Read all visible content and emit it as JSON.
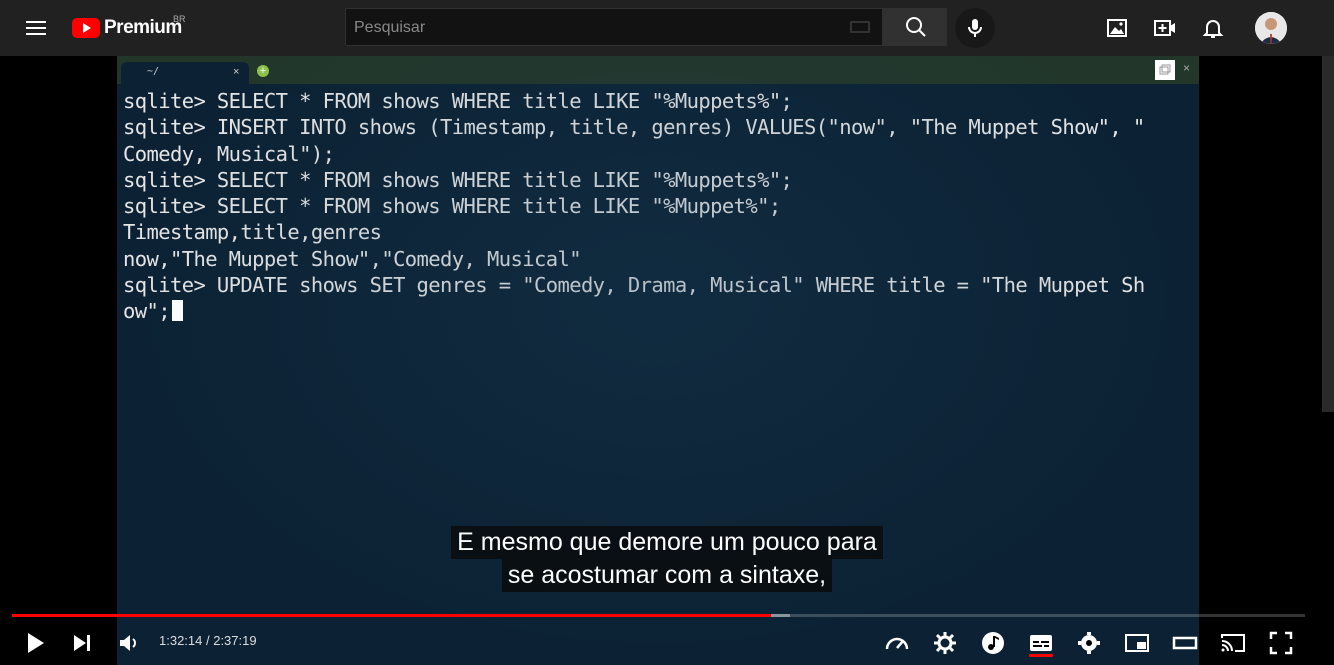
{
  "header": {
    "brand": "Premium",
    "region": "BR",
    "search_placeholder": "Pesquisar",
    "icons": [
      "menu-icon",
      "youtube-logo-icon",
      "keyboard-icon",
      "search-icon",
      "mic-icon",
      "image-icon",
      "create-video-icon",
      "notifications-icon",
      "avatar"
    ]
  },
  "terminal": {
    "tab_label": "~/",
    "tab_close": "×",
    "tab_add": "+",
    "window_close": "×",
    "text": "sqlite> SELECT * FROM shows WHERE title LIKE \"%Muppets%\";\nsqlite> INSERT INTO shows (Timestamp, title, genres) VALUES(\"now\", \"The Muppet Show\", \"\nComedy, Musical\");\nsqlite> SELECT * FROM shows WHERE title LIKE \"%Muppets%\";\nsqlite> SELECT * FROM shows WHERE title LIKE \"%Muppet%\";\nTimestamp,title,genres\nnow,\"The Muppet Show\",\"Comedy, Musical\"\nsqlite> UPDATE shows SET genres = \"Comedy, Drama, Musical\" WHERE title = \"The Muppet Sh\now\";"
  },
  "captions": {
    "line1": "E mesmo que demore um pouco para",
    "line2": "se acostumar com a sintaxe,"
  },
  "player": {
    "time_display": "1:32:14 / 2:37:19",
    "progress_fraction": 0.587,
    "buffer_fraction": 0.602,
    "accent_color": "#ff0000",
    "icons": [
      "play-icon",
      "next-icon",
      "volume-icon",
      "speed-icon",
      "settings-gear-icon",
      "music-icon",
      "subtitles-icon",
      "settings-icon",
      "miniplayer-icon",
      "theater-mode-icon",
      "cast-icon",
      "fullscreen-icon"
    ]
  }
}
